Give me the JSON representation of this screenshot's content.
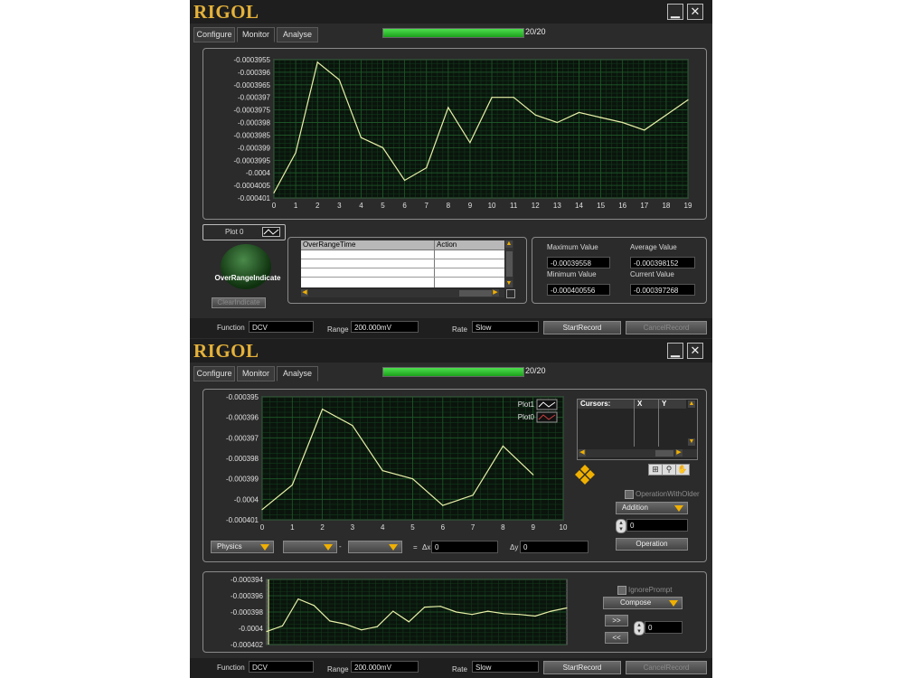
{
  "app": {
    "logo": "RIGOL",
    "minimize_glyph": "▁",
    "close_glyph": "✕"
  },
  "tabs": [
    "Configure",
    "Monitor",
    "Analyse"
  ],
  "progress": {
    "text": "20/20",
    "fraction": 1.0
  },
  "monitor": {
    "chart_data": {
      "type": "line",
      "x": [
        0,
        1,
        2,
        3,
        4,
        5,
        6,
        7,
        8,
        9,
        10,
        11,
        12,
        13,
        14,
        15,
        16,
        17,
        18,
        19
      ],
      "values": [
        -0.0004008,
        -0.0003992,
        -0.0003956,
        -0.0003963,
        -0.0003986,
        -0.000399,
        -0.0004003,
        -0.0003998,
        -0.0003974,
        -0.0003988,
        -0.000397,
        -0.000397,
        -0.0003977,
        -0.000398,
        -0.0003976,
        -0.0003978,
        -0.000398,
        -0.0003983,
        -0.0003977,
        -0.0003971
      ],
      "xlim": [
        0,
        19
      ],
      "ylim": [
        -0.000401,
        -0.0003955
      ],
      "yticks": [
        "-0.0003955",
        "-0.000396",
        "-0.0003965",
        "-0.000397",
        "-0.0003975",
        "-0.000398",
        "-0.0003985",
        "-0.000399",
        "-0.0003995",
        "-0.0004",
        "-0.0004005",
        "-0.000401"
      ],
      "xticks": [
        "0",
        "1",
        "2",
        "3",
        "4",
        "5",
        "6",
        "7",
        "8",
        "9",
        "10",
        "11",
        "12",
        "13",
        "14",
        "15",
        "16",
        "17",
        "18",
        "19"
      ],
      "line_color": "#e8f0a8",
      "grid_color": "#1f5a2a"
    },
    "plot_legend": "Plot 0",
    "over_range_indicator": "OverRangeIndicate",
    "clear_indicate": "ClearIndicate",
    "table_headers": [
      "OverRangeTime",
      "Action"
    ],
    "stats": {
      "max_label": "Maximum Value",
      "max_value": "-0.00039558",
      "avg_label": "Average Value",
      "avg_value": "-0.000398152",
      "min_label": "Minimum Value",
      "min_value": "-0.000400556",
      "cur_label": "Current Value",
      "cur_value": "-0.000397268"
    }
  },
  "analyse": {
    "chart_data": {
      "type": "line",
      "x": [
        0,
        1,
        2,
        3,
        4,
        5,
        6,
        7,
        8,
        9
      ],
      "series": [
        {
          "name": "Plot1",
          "values": []
        },
        {
          "name": "Plot0",
          "values": [
            -0.0004005,
            -0.0003993,
            -0.0003956,
            -0.0003964,
            -0.0003986,
            -0.000399,
            -0.0004003,
            -0.0003998,
            -0.0003974,
            -0.0003988
          ]
        }
      ],
      "xlim": [
        0,
        10
      ],
      "ylim": [
        -0.000401,
        -0.000395
      ],
      "yticks": [
        "-0.000395",
        "-0.000396",
        "-0.000397",
        "-0.000398",
        "-0.000399",
        "-0.0004",
        "-0.000401"
      ],
      "xticks": [
        "0",
        "1",
        "2",
        "3",
        "4",
        "5",
        "6",
        "7",
        "8",
        "9",
        "10"
      ],
      "line_color": "#e8f0a8",
      "legend": "top-right"
    },
    "cursors_headers": [
      "Cursors:",
      "X",
      "Y"
    ],
    "operation_with_older": "OperationWithOlder",
    "addition": "Addition",
    "operation_value": "0",
    "operation_button": "Operation",
    "physics": "Physics",
    "minus": "-",
    "dx_label": "Δx",
    "dx_value": "0",
    "dy_label": "Δy",
    "dy_value": "0",
    "overview": {
      "yticks": [
        "-0.000394",
        "-0.000396",
        "-0.000398",
        "-0.0004",
        "-0.000402"
      ],
      "ylim": [
        -0.000402,
        -0.000394
      ],
      "values": [
        -0.0004004,
        -0.0003997,
        -0.0003964,
        -0.0003972,
        -0.0003991,
        -0.0003995,
        -0.0004002,
        -0.0003998,
        -0.0003979,
        -0.0003992,
        -0.0003974,
        -0.0003973,
        -0.000398,
        -0.0003983,
        -0.0003979,
        -0.0003982,
        -0.0003983,
        -0.0003985,
        -0.0003979,
        -0.0003975
      ]
    },
    "ignore_prompt": "IgnorePrompt",
    "compose": "Compose",
    "next_btn": ">>",
    "prev_btn": "<<",
    "compose_value": "0"
  },
  "bottom": {
    "function_label": "Function",
    "function_value": "DCV",
    "range_label": "Range",
    "range_value": "200.000mV",
    "rate_label": "Rate",
    "rate_value": "Slow",
    "start_record": "StartRecord",
    "cancel_record": "CancelRecord"
  }
}
